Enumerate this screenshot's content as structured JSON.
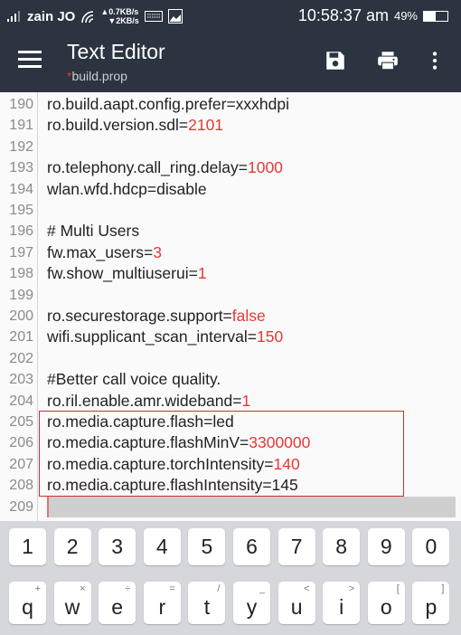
{
  "status": {
    "carrier": "zain JO",
    "up": "▲0.7KB/s",
    "down": "▼2KB/s",
    "time": "10:58:37 am",
    "battery": "49%",
    "battery_level": 0.49
  },
  "toolbar": {
    "title": "Text Editor",
    "modified_mark": "*",
    "filename": "build.prop",
    "icons": [
      "menu-icon",
      "save-icon",
      "print-icon",
      "more-vert-icon"
    ]
  },
  "editor": {
    "lines": [
      {
        "n": "190",
        "k": "ro.build.aapt.config.prefer=xxxhdpi",
        "v": ""
      },
      {
        "n": "191",
        "k": "ro.build.version.sdl=",
        "v": "2101"
      },
      {
        "n": "192",
        "k": "",
        "v": ""
      },
      {
        "n": "193",
        "k": "ro.telephony.call_ring.delay=",
        "v": "1000"
      },
      {
        "n": "194",
        "k": "wlan.wfd.hdcp=disable",
        "v": ""
      },
      {
        "n": "195",
        "k": "",
        "v": ""
      },
      {
        "n": "196",
        "k": "# Multi Users",
        "v": ""
      },
      {
        "n": "197",
        "k": "fw.max_users=",
        "v": "3"
      },
      {
        "n": "198",
        "k": "fw.show_multiuserui=",
        "v": "1"
      },
      {
        "n": "199",
        "k": "",
        "v": ""
      },
      {
        "n": "200",
        "k": "ro.securestorage.support=",
        "v": "false"
      },
      {
        "n": "201",
        "k": "wifi.supplicant_scan_interval=",
        "v": "150"
      },
      {
        "n": "202",
        "k": "",
        "v": ""
      },
      {
        "n": "203",
        "k": "#Better call voice quality.",
        "v": ""
      },
      {
        "n": "204",
        "k": "ro.ril.enable.amr.wideband=",
        "v": "1"
      },
      {
        "n": "205",
        "k": "ro.media.capture.flash=led",
        "v": ""
      },
      {
        "n": "206",
        "k": "ro.media.capture.flashMinV=",
        "v": "3300000"
      },
      {
        "n": "207",
        "k": "ro.media.capture.torchIntensity=",
        "v": "140"
      },
      {
        "n": "208",
        "k": "ro.media.capture.flashIntensity=145",
        "v": ""
      },
      {
        "n": "209",
        "k": "",
        "v": ""
      }
    ],
    "value_color": "#e53935",
    "highlight_color": "#d32f2f"
  },
  "keyboard": {
    "row1": [
      {
        "k": "1"
      },
      {
        "k": "2"
      },
      {
        "k": "3"
      },
      {
        "k": "4"
      },
      {
        "k": "5"
      },
      {
        "k": "6"
      },
      {
        "k": "7"
      },
      {
        "k": "8"
      },
      {
        "k": "9"
      },
      {
        "k": "0"
      }
    ],
    "row2": [
      {
        "k": "q",
        "s": "+"
      },
      {
        "k": "w",
        "s": "×"
      },
      {
        "k": "e",
        "s": "÷"
      },
      {
        "k": "r",
        "s": "="
      },
      {
        "k": "t",
        "s": "/"
      },
      {
        "k": "y",
        "s": "_"
      },
      {
        "k": "u",
        "s": "<"
      },
      {
        "k": "i",
        "s": ">"
      },
      {
        "k": "o",
        "s": "["
      },
      {
        "k": "p",
        "s": "]"
      }
    ]
  }
}
